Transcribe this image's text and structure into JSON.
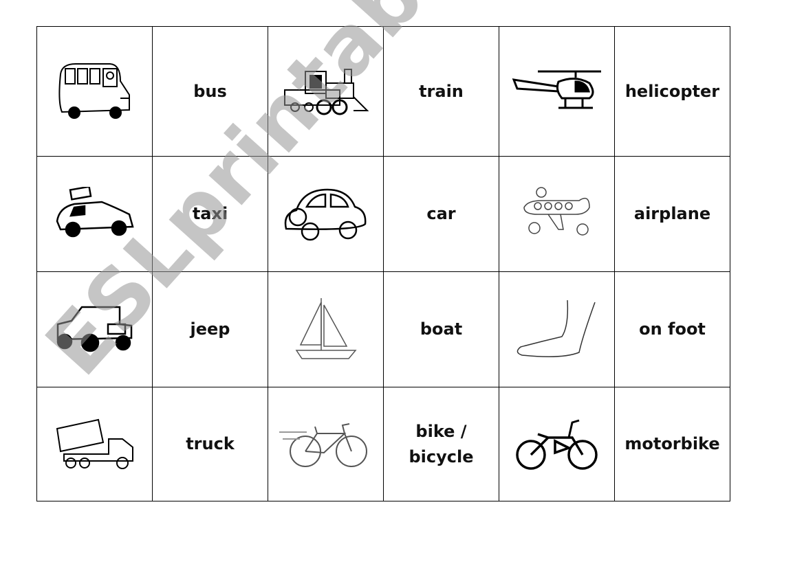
{
  "cards": [
    [
      {
        "icon": "bus-icon"
      },
      {
        "word": "bus"
      },
      {
        "icon": "train-icon"
      },
      {
        "word": "train"
      },
      {
        "icon": "helicopter-icon"
      },
      {
        "word": "helicopter"
      }
    ],
    [
      {
        "icon": "taxi-icon"
      },
      {
        "word": "taxi"
      },
      {
        "icon": "car-icon"
      },
      {
        "word": "car"
      },
      {
        "icon": "airplane-icon"
      },
      {
        "word": "airplane"
      }
    ],
    [
      {
        "icon": "jeep-icon"
      },
      {
        "word": "jeep"
      },
      {
        "icon": "boat-icon"
      },
      {
        "word": "boat"
      },
      {
        "icon": "foot-icon"
      },
      {
        "word": "on foot"
      }
    ],
    [
      {
        "icon": "truck-icon"
      },
      {
        "word": "truck"
      },
      {
        "icon": "bicycle-icon"
      },
      {
        "word": "bike /\nbicycle"
      },
      {
        "icon": "motorbike-icon"
      },
      {
        "word": "motorbike"
      }
    ]
  ],
  "watermark": "ESLprintables.com"
}
